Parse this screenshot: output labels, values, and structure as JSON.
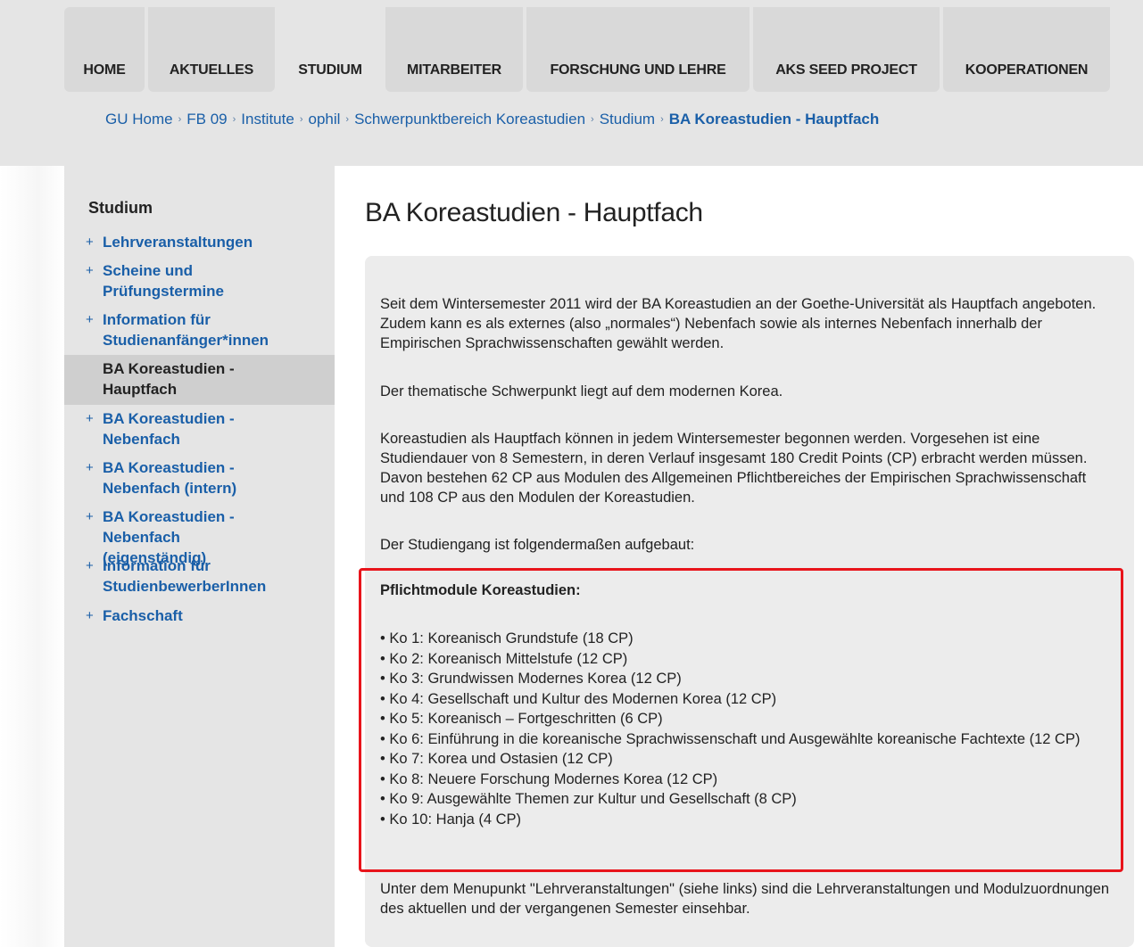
{
  "nav": {
    "tabs": [
      "HOME",
      "AKTUELLES",
      "STUDIUM",
      "MITARBEITER",
      "FORSCHUNG UND LEHRE",
      "AKS SEED PROJECT",
      "KOOPERATIONEN"
    ],
    "active": "STUDIUM"
  },
  "breadcrumb": {
    "items": [
      "GU Home",
      "FB 09",
      "Institute",
      "ophil",
      "Schwerpunktbereich Koreastudien",
      "Studium"
    ],
    "current": "BA Koreastudien - Hauptfach"
  },
  "sidebar": {
    "title": "Studium",
    "items": [
      {
        "label": "Lehrveranstaltungen",
        "prefix": "+"
      },
      {
        "label": "Scheine und Prüfungstermine",
        "prefix": "+"
      },
      {
        "label": "Information für Studienanfänger*innen",
        "prefix": "+"
      },
      {
        "label": "BA Koreastudien - Hauptfach",
        "prefix": ""
      },
      {
        "label": "BA Koreastudien - Nebenfach",
        "prefix": "+"
      },
      {
        "label": "BA Koreastudien - Nebenfach (intern)",
        "prefix": "+"
      },
      {
        "label": "BA Koreastudien - Nebenfach (eigenständig)",
        "prefix": "+"
      },
      {
        "label": "Information für StudienbewerberInnen",
        "prefix": "+"
      },
      {
        "label": "Fachschaft",
        "prefix": "+"
      }
    ]
  },
  "main": {
    "title": "BA Koreastudien - Hauptfach",
    "p1": "Seit dem Wintersemester 2011 wird der BA Koreastudien an der Goethe-Universität als Hauptfach angeboten. Zudem kann es als externes (also „normales“) Nebenfach sowie als internes Nebenfach innerhalb der Empirischen Sprachwissenschaften gewählt werden.",
    "p2": "Der thematische Schwerpunkt liegt auf dem modernen Korea.",
    "p3": "Koreastudien als Hauptfach können in jedem Wintersemester begonnen werden. Vorgesehen ist eine Studiendauer von 8 Semestern, in deren Verlauf insgesamt 180 Credit Points (CP) erbracht werden müssen. Davon bestehen 62 CP aus Modulen des Allgemeinen Pflichtbereiches der Empirischen Sprachwissenschaft und 108 CP aus den Modulen der Koreastudien.",
    "p4": "Der Studiengang ist folgendermaßen aufgebaut:",
    "modules_heading": "Pflichtmodule Koreastudien:",
    "modules": [
      "• Ko 1: Koreanisch Grundstufe (18 CP)",
      "• Ko 2: Koreanisch Mittelstufe (12 CP)",
      "• Ko 3: Grundwissen Modernes Korea (12 CP)",
      "• Ko 4: Gesellschaft und Kultur des Modernen Korea (12 CP)",
      "• Ko 5: Koreanisch – Fortgeschritten (6 CP)",
      "• Ko 6: Einführung in die koreanische Sprachwissenschaft und Ausgewählte koreanische Fachtexte (12 CP)",
      "• Ko 7: Korea und Ostasien (12 CP)",
      "• Ko 8: Neuere Forschung Modernes Korea (12 CP)",
      "• Ko 9: Ausgewählte Themen zur Kultur und Gesellschaft (8 CP)",
      "• Ko 10: Hanja (4 CP)"
    ],
    "p5": "Unter dem Menupunkt \"Lehrveranstaltungen\" (siehe links) sind die Lehrveranstaltungen und Modulzuordnungen des aktuellen und der vergangenen Semester einsehbar."
  },
  "colors": {
    "link": "#1a5fa8",
    "highlight_border": "#e8141b",
    "panel": "#e5e5e5"
  }
}
